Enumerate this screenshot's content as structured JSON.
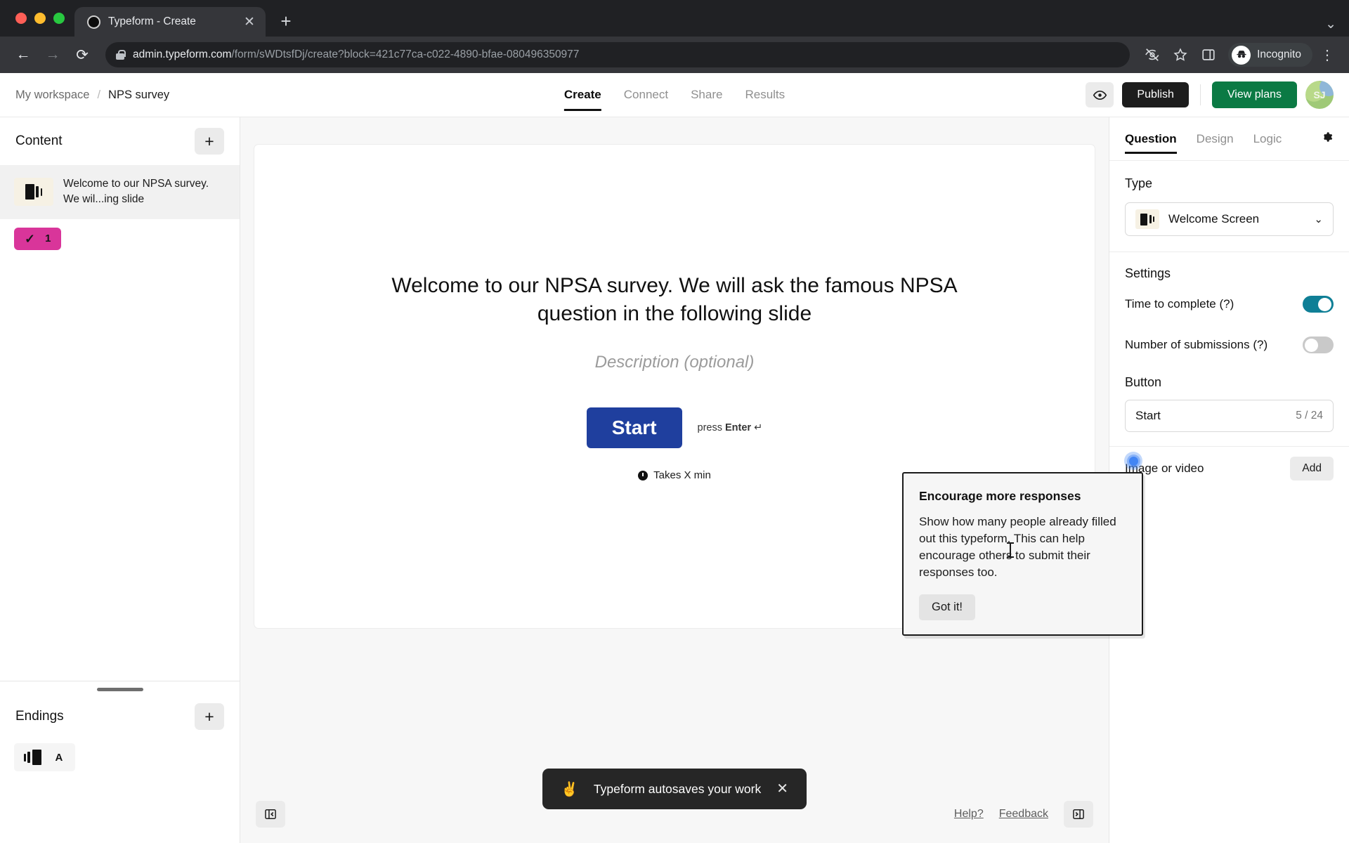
{
  "browser": {
    "tab_title": "Typeform - Create",
    "tab_close_icon": "close-icon",
    "new_tab_icon": "plus-icon",
    "tab_list_icon": "chevron-down-icon",
    "back_icon": "arrow-left-icon",
    "forward_icon": "arrow-right-icon",
    "reload_icon": "reload-icon",
    "lock_icon": "lock-icon",
    "url_host": "admin.typeform.com",
    "url_path": "/form/sWDtsfDj/create?block=421c77ca-c022-4890-bfae-080496350977",
    "hide_icon": "eye-slash-icon",
    "bookmark_icon": "star-icon",
    "sidepanel_icon": "side-panel-icon",
    "incognito_label": "Incognito",
    "incognito_icon": "incognito-hat-icon",
    "menu_icon": "kebab-menu-icon"
  },
  "header": {
    "workspace": "My workspace",
    "separator": "/",
    "form_name": "NPS survey",
    "nav": [
      {
        "label": "Create",
        "active": true
      },
      {
        "label": "Connect",
        "active": false
      },
      {
        "label": "Share",
        "active": false
      },
      {
        "label": "Results",
        "active": false
      }
    ],
    "preview_icon": "eye-icon",
    "publish_label": "Publish",
    "view_plans_label": "View plans",
    "avatar_initials": "SJ"
  },
  "sidebar": {
    "content_title": "Content",
    "add_content_icon": "plus-icon",
    "content_items": [
      {
        "text": "Welcome to our NPSA survey. We wil...ing slide",
        "thumb_icon": "welcome-screen-icon"
      }
    ],
    "question_badge": {
      "tick_icon": "check-icon",
      "number": "1"
    },
    "endings_title": "Endings",
    "add_ending_icon": "plus-icon",
    "endings_items": [
      {
        "thumb_icon": "ending-screen-icon",
        "letter": "A"
      }
    ]
  },
  "canvas": {
    "slide_title": "Welcome to our NPSA survey. We will ask the famous NPSA question in the following slide",
    "description_placeholder": "Description (optional)",
    "start_button_label": "Start",
    "press_enter_prefix": "press ",
    "press_enter_key": "Enter",
    "press_enter_symbol": "↵",
    "time_icon": "clock-icon",
    "time_label": "Takes X min",
    "toast": {
      "emoji": "✌️",
      "text": "Typeform autosaves your work",
      "close_icon": "close-icon"
    },
    "collapse_left_icon": "collapse-left-panel-icon",
    "collapse_right_icon": "collapse-right-panel-icon",
    "help_label": "Help?",
    "feedback_label": "Feedback"
  },
  "right_panel": {
    "tabs": [
      {
        "label": "Question",
        "active": true
      },
      {
        "label": "Design",
        "active": false
      },
      {
        "label": "Logic",
        "active": false
      }
    ],
    "settings_gear_icon": "gear-icon",
    "type_label": "Type",
    "type_value": "Welcome Screen",
    "type_thumb_icon": "welcome-screen-icon",
    "type_chevron_icon": "chevron-down-icon",
    "settings_label": "Settings",
    "settings": [
      {
        "label": "Time to complete (?)",
        "on": true
      },
      {
        "label": "Number of submissions (?)",
        "on": false
      }
    ],
    "button_label": "Button",
    "button_value": "Start",
    "button_counter": "5 / 24",
    "media_label": "Image or video",
    "media_add_label": "Add",
    "collapse_icon": "collapse-right-panel-icon"
  },
  "tour_popover": {
    "title": "Encourage more responses",
    "body": "Show how many people already filled out this typeform. This can help encourage others to submit their responses too.",
    "button_label": "Got it!",
    "beacon_icon": "pulsing-beacon-icon"
  },
  "colors": {
    "publish_bg": "#1d1d1d",
    "view_plans_bg": "#0b7a44",
    "start_button_bg": "#1f3f9e",
    "question_badge_bg": "#d9359a",
    "toggle_on": "#0f7f96",
    "beacon": "#4285f4"
  }
}
